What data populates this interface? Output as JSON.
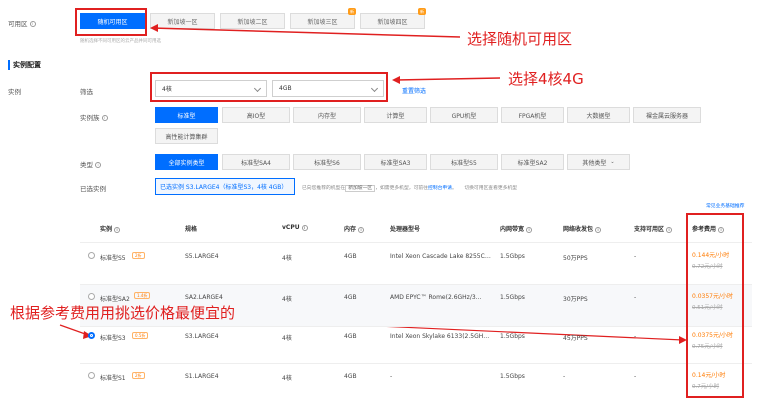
{
  "zone": {
    "label": "可用区",
    "tabs": [
      {
        "label": "随机可用区",
        "tag": ""
      },
      {
        "label": "新加坡一区",
        "tag": ""
      },
      {
        "label": "新加坡二区",
        "tag": ""
      },
      {
        "label": "新加坡三区",
        "tag": "新"
      },
      {
        "label": "新加坡四区",
        "tag": "新"
      }
    ],
    "hint": "随机选择不同可用区的云产品并同可用选"
  },
  "section_title": "实例配置",
  "instance": {
    "label": "实例",
    "filter_label": "筛选",
    "cpu_value": "4核",
    "mem_value": "4GB",
    "reset_link": "重置筛选"
  },
  "family": {
    "label": "实例族",
    "row1": [
      "标准型",
      "高IO型",
      "内存型",
      "计算型",
      "GPU机型",
      "FPGA机型",
      "大数据型",
      "裸金属云服务器"
    ],
    "row2": [
      "高性能计算集群"
    ]
  },
  "type": {
    "label": "类型",
    "items": [
      "全部实例类型",
      "标准型SA4",
      "标准型S6",
      "标准型SA3",
      "标准型S5",
      "标准型SA2",
      "其他类型"
    ]
  },
  "selected": {
    "label": "已选实例",
    "value": "已选实例 S3.LARGE4（标准型S3，4核 4GB）",
    "note_prefix": "已向您推荐的机型在",
    "note_zone": "新加坡一区",
    "note_mid": "，如需更多机型，可前往",
    "note_link": "控制台申请",
    "note_suffix": "。",
    "note2": "切换可用区查看更多机型"
  },
  "table_link": "常见业务基础推荐",
  "table": {
    "headers": [
      "实例",
      "规格",
      "vCPU",
      "内存",
      "处理器型号",
      "内网带宽",
      "网络收发包",
      "支持可用区",
      "参考费用"
    ],
    "rows": [
      {
        "name": "标准型S5",
        "badge": "2折",
        "spec": "S5.LARGE4",
        "vcpu": "4核",
        "mem": "4GB",
        "cpu": "Intel Xeon Cascade Lake 8255C…",
        "bw": "1.5Gbps",
        "pps": "50万PPS",
        "zone": "-",
        "price": "0.144元/小时",
        "old": "0.72元/小时"
      },
      {
        "name": "标准型SA2",
        "badge": "1.4折",
        "spec": "SA2.LARGE4",
        "vcpu": "4核",
        "mem": "4GB",
        "cpu": "AMD EPYC™ Rome(2.6GHz/3…",
        "bw": "1.5Gbps",
        "pps": "30万PPS",
        "zone": "-",
        "price": "0.0357元/小时",
        "old": "0.51元/小时"
      },
      {
        "name": "标准型S3",
        "badge": "0.5折",
        "spec": "S3.LARGE4",
        "vcpu": "4核",
        "mem": "4GB",
        "cpu": "Intel Xeon Skylake 6133(2.5GH…",
        "bw": "1.5Gbps",
        "pps": "45万PPS",
        "zone": "-",
        "price": "0.0375元/小时",
        "old": "0.75元/小时"
      },
      {
        "name": "标准型S1",
        "badge": "2折",
        "spec": "S1.LARGE4",
        "vcpu": "4核",
        "mem": "4GB",
        "cpu": "-",
        "bw": "1.5Gbps",
        "pps": "-",
        "zone": "-",
        "price": "0.14元/小时",
        "old": "0.7元/小时"
      }
    ]
  },
  "annotations": {
    "zone": "选择随机可用区",
    "cpu": "选择4核4G",
    "price": "根据参考费用用挑选价格最便宜的"
  },
  "colors": {
    "accent": "#006eff",
    "annotation": "#e02020",
    "price": "#ff7a00"
  }
}
